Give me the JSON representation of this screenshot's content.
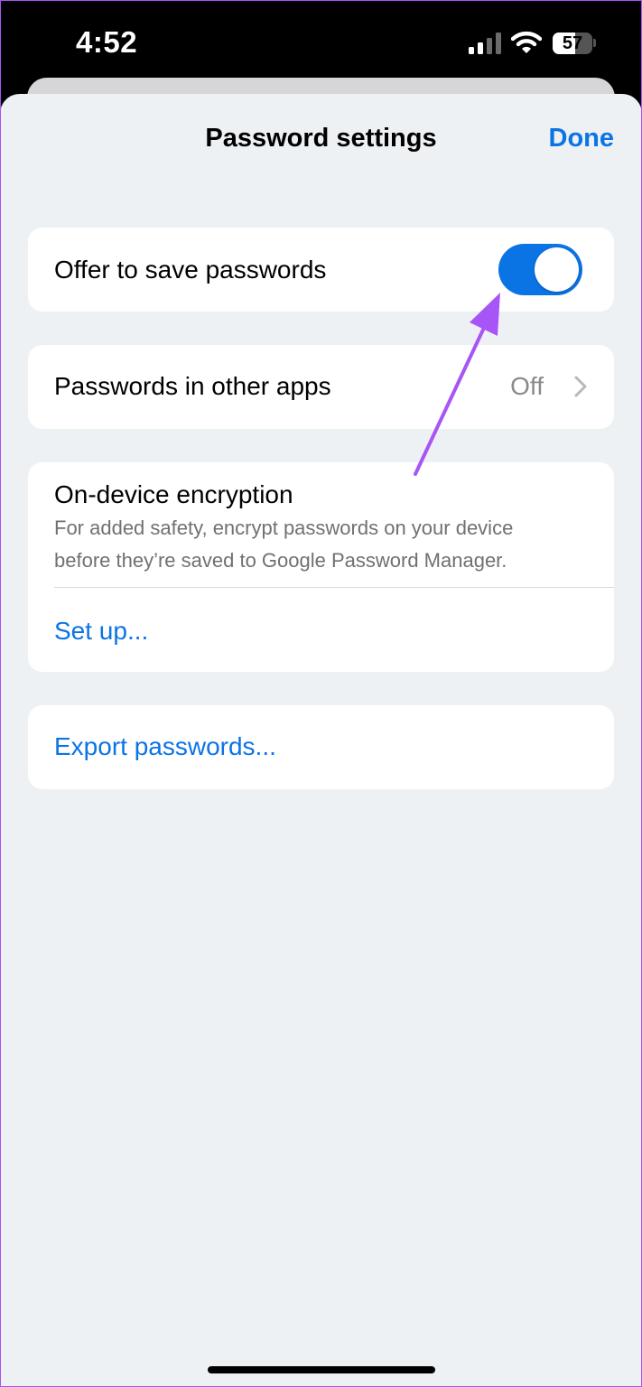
{
  "status_bar": {
    "time": "4:52",
    "battery_level": "57",
    "signal_icon": "cellular-signal-icon",
    "wifi_icon": "wifi-icon"
  },
  "sheet": {
    "title": "Password settings",
    "done_label": "Done"
  },
  "offer_to_save": {
    "label": "Offer to save passwords",
    "toggle_on": true
  },
  "other_apps": {
    "label": "Passwords in other apps",
    "value": "Off",
    "icon": "chevron-right-icon"
  },
  "encryption": {
    "title": "On-device encryption",
    "description_line1": "For added safety, encrypt passwords on your device",
    "description_line2": "before they’re saved to Google Password Manager.",
    "setup_label": "Set up..."
  },
  "export": {
    "label": "Export passwords..."
  },
  "colors": {
    "accent": "#0b74e5",
    "sheet_background": "#eef1f3",
    "annotation_arrow": "#a855f7"
  }
}
